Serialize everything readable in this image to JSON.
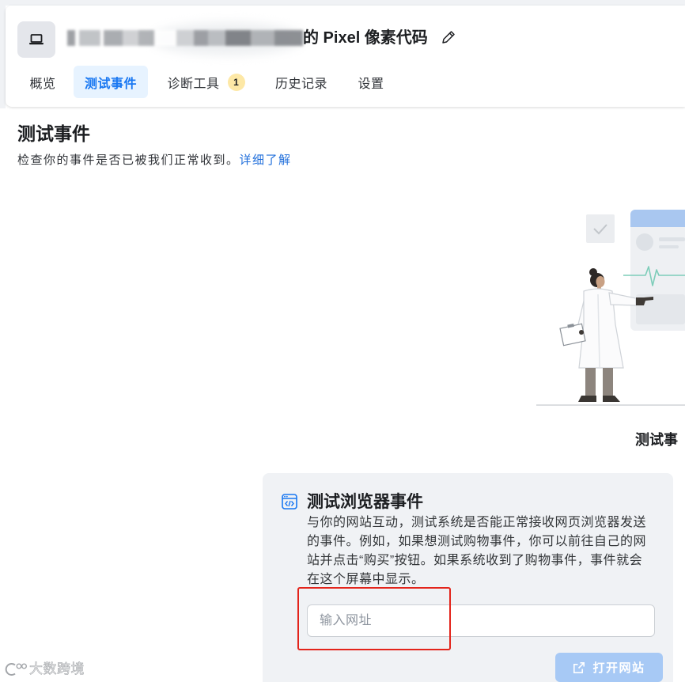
{
  "header": {
    "title": "的 Pixel 像素代码",
    "icons": {
      "app": "laptop-icon",
      "edit": "pencil-icon"
    },
    "tabs": [
      {
        "label": "概览",
        "selected": false
      },
      {
        "label": "测试事件",
        "selected": true
      },
      {
        "label": "诊断工具",
        "badge": "1",
        "selected": false
      },
      {
        "label": "历史记录",
        "selected": false
      },
      {
        "label": "设置",
        "selected": false
      }
    ]
  },
  "page": {
    "title": "测试事件",
    "subtitle": "检查你的事件是否已被我们正常收到。",
    "learn_more": "详细了解"
  },
  "illustration": {
    "caption": "测试事"
  },
  "browser_events_card": {
    "icon": "browser-code-icon",
    "title": "测试浏览器事件",
    "description_lines": [
      "与你的网站互动，测试系统是否能正常接收网页浏览器发送",
      "的事件。例如，如果想测试购物事件，你可以前往自己的网",
      "站并点击“购买”按钮。如果系统收到了购物事件，事件就会",
      "在这个屏幕中显示。"
    ],
    "url_input": {
      "placeholder": "输入网址",
      "value": ""
    },
    "open_button": {
      "label": "打开网站",
      "icon": "external-link-icon",
      "enabled": false
    }
  },
  "watermark": {
    "text": "大数跨境"
  },
  "colors": {
    "accent": "#1877f2",
    "selected_tab_bg": "#e7f3ff",
    "badge_bg": "#fde8a6",
    "card_bg": "#f0f2f5",
    "button_disabled_bg": "#a7c9f5",
    "annotation_border": "#e3241b"
  }
}
